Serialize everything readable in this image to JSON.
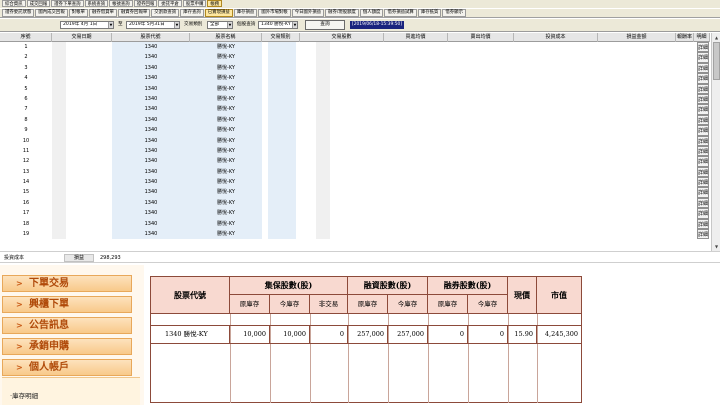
{
  "tabs_row1": [
    {
      "label": "綜合資訊",
      "active": false
    },
    {
      "label": "成交回報",
      "active": false
    },
    {
      "label": "證券下單查詢",
      "active": false
    },
    {
      "label": "系統查詢",
      "active": false
    },
    {
      "label": "帳號查詢",
      "active": false
    },
    {
      "label": "證券回報",
      "active": false
    },
    {
      "label": "委託平倉",
      "active": false
    },
    {
      "label": "股票申購",
      "active": false
    },
    {
      "label": "帳務",
      "active": true
    }
  ],
  "tabs_row2": [
    {
      "label": "證券委託狀態",
      "active": false
    },
    {
      "label": "國內成交回報",
      "active": false
    },
    {
      "label": "對帳單",
      "active": false
    },
    {
      "label": "融券借貸單",
      "active": false
    },
    {
      "label": "融資券回報單",
      "active": false
    },
    {
      "label": "交割款查詢",
      "active": false
    },
    {
      "label": "庫存查詢",
      "active": false
    },
    {
      "label": "已實現損益",
      "active": true
    },
    {
      "label": "庫存損益",
      "active": false
    },
    {
      "label": "國外市場對帳",
      "active": false
    },
    {
      "label": "今日國外損益",
      "active": false
    },
    {
      "label": "融券/現股額度",
      "active": false
    },
    {
      "label": "個人額度",
      "active": false
    },
    {
      "label": "借券損益試算",
      "active": false
    },
    {
      "label": "庫存抵質",
      "active": false
    },
    {
      "label": "借券顯示",
      "active": false
    }
  ],
  "filter": {
    "date_from": "2019年 4月 1日",
    "date_to_label": "至",
    "date_to": "2019年 5月31日",
    "type_label": "交易類別",
    "type_value": "全部",
    "stock_label": "個股查詢",
    "stock_value": "1340 勝悅-KY",
    "query_button": "查詢",
    "timestamp": "[2019/06/18-15:39:50]"
  },
  "grid": {
    "columns": [
      "序號",
      "交易日期",
      "股票代號",
      "股票名稱",
      "交易類別",
      "交易股數",
      "買進均價",
      "賣出均價",
      "投資成本",
      "損益金額",
      "報酬率",
      "明細"
    ],
    "detail_label": "詳細",
    "rows": [
      {
        "no": "1",
        "code": "1340",
        "name": "勝悅-KY"
      },
      {
        "no": "2",
        "code": "1340",
        "name": "勝悅-KY"
      },
      {
        "no": "3",
        "code": "1340",
        "name": "勝悅-KY"
      },
      {
        "no": "4",
        "code": "1340",
        "name": "勝悅-KY"
      },
      {
        "no": "5",
        "code": "1340",
        "name": "勝悅-KY"
      },
      {
        "no": "6",
        "code": "1340",
        "name": "勝悅-KY"
      },
      {
        "no": "7",
        "code": "1340",
        "name": "勝悅-KY"
      },
      {
        "no": "8",
        "code": "1340",
        "name": "勝悅-KY"
      },
      {
        "no": "9",
        "code": "1340",
        "name": "勝悅-KY"
      },
      {
        "no": "10",
        "code": "1340",
        "name": "勝悅-KY"
      },
      {
        "no": "11",
        "code": "1340",
        "name": "勝悅-KY"
      },
      {
        "no": "12",
        "code": "1340",
        "name": "勝悅-KY"
      },
      {
        "no": "13",
        "code": "1340",
        "name": "勝悅-KY"
      },
      {
        "no": "14",
        "code": "1340",
        "name": "勝悅-KY"
      },
      {
        "no": "15",
        "code": "1340",
        "name": "勝悅-KY"
      },
      {
        "no": "16",
        "code": "1340",
        "name": "勝悅-KY"
      },
      {
        "no": "17",
        "code": "1340",
        "name": "勝悅-KY"
      },
      {
        "no": "18",
        "code": "1340",
        "name": "勝悅-KY"
      },
      {
        "no": "19",
        "code": "1340",
        "name": "勝悅-KY"
      }
    ]
  },
  "summary": {
    "cost_label": "投資成本",
    "pnl_label": "損益",
    "pnl_value": "298,293"
  },
  "nav": {
    "items": [
      "下單交易",
      "興櫃下單",
      "公告訊息",
      "承銷申購",
      "個人帳戶"
    ],
    "sub_item": "‧庫存明細"
  },
  "inventory": {
    "headers": {
      "stock_code": "股票代號",
      "group_cash": "集保股數(股)",
      "group_margin": "融資股數(股)",
      "group_short": "融券股數(股)",
      "price": "現價",
      "market_value": "市值",
      "original": "原庫存",
      "current": "今庫存",
      "non_trading": "非交易"
    },
    "row": {
      "stock": "1340 勝悅-KY",
      "cash_original": "10,000",
      "cash_current": "10,000",
      "cash_non_trading": "0",
      "margin_original": "257,000",
      "margin_current": "257,000",
      "short_original": "0",
      "short_current": "0",
      "price": "15.90",
      "market_value": "4,245,300"
    }
  },
  "colors": {
    "window_bg": "#ece9d8",
    "active_tab": "#ffe8a0",
    "grid_blue_col": "#e4eef8",
    "timestamp_bg": "#1a237e",
    "nav_text": "#b04a0a",
    "inv_header_bg": "#f8d9d0",
    "inv_border": "#8c4a3a"
  }
}
